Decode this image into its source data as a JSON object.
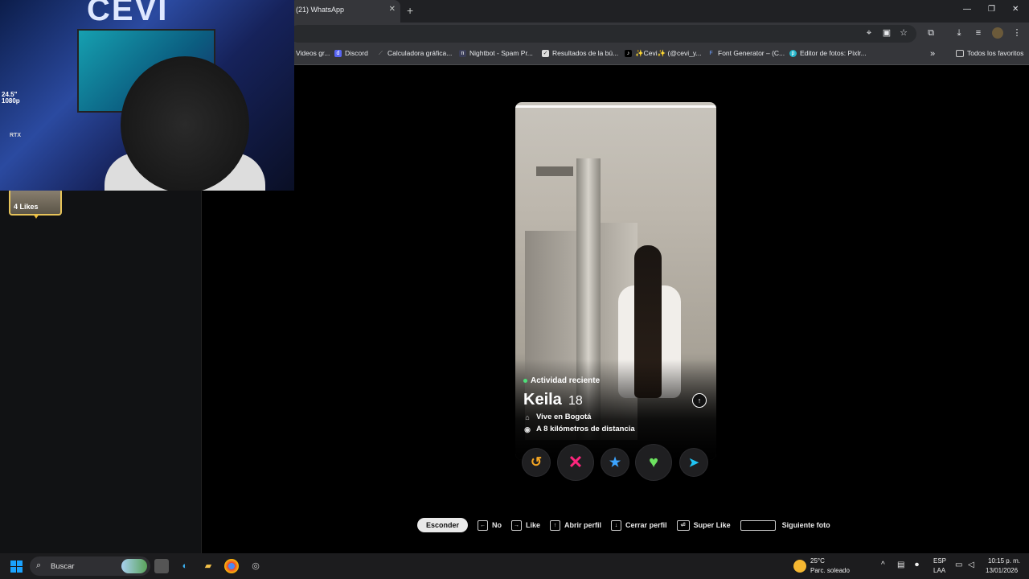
{
  "browser": {
    "tab_title": "(21) WhatsApp",
    "bookmarks": [
      {
        "label": "Videos gr...",
        "icon": "video-icon"
      },
      {
        "label": "Discord",
        "icon": "discord-icon"
      },
      {
        "label": "Calculadora gráfica...",
        "icon": "calculator-icon"
      },
      {
        "label": "Nightbot - Spam Pr...",
        "icon": "nightbot-icon"
      },
      {
        "label": "Resultados de la bú...",
        "icon": "search-results-icon"
      },
      {
        "label": "✨Cevi✨ (@cevi_y...",
        "icon": "tiktok-icon"
      },
      {
        "label": "Font Generator – (C...",
        "icon": "font-icon"
      },
      {
        "label": "Editor de fotos: Pixlr...",
        "icon": "pixlr-icon"
      }
    ],
    "all_bookmarks": "Todos los favoritos"
  },
  "webcam": {
    "brand": "CEVI",
    "monitor_line1": "24.5\"",
    "monitor_line2": "1080p",
    "gpu": "RTX"
  },
  "sidebar": {
    "likes_label": "4 Likes"
  },
  "profile": {
    "activity": "Actividad reciente",
    "name": "Keila",
    "age": "18",
    "lives_in": "Vive en Bogotá",
    "distance": "A 8 kilómetros de distancia"
  },
  "actions": {
    "rewind": "rewind-icon",
    "nope": "nope-icon",
    "superlike": "superlike-icon",
    "like": "like-icon",
    "boost": "boost-icon",
    "colors": {
      "rewind": "#f5a623",
      "nope": "#fd267d",
      "superlike": "#3ca4ff",
      "like": "#6ce25f",
      "boost": "#20c4f4"
    }
  },
  "shortcuts": {
    "hide": "Esconder",
    "no": "No",
    "like": "Like",
    "open_profile": "Abrir perfil",
    "close_profile": "Cerrar perfil",
    "super_like": "Super Like",
    "next_photo": "Siguiente foto"
  },
  "taskbar": {
    "search_placeholder": "Buscar",
    "temperature": "25°C",
    "weather": "Parc. soleado",
    "lang1": "ESP",
    "lang2": "LAA",
    "time": "10:15 p. m.",
    "date": "13/01/2026"
  }
}
